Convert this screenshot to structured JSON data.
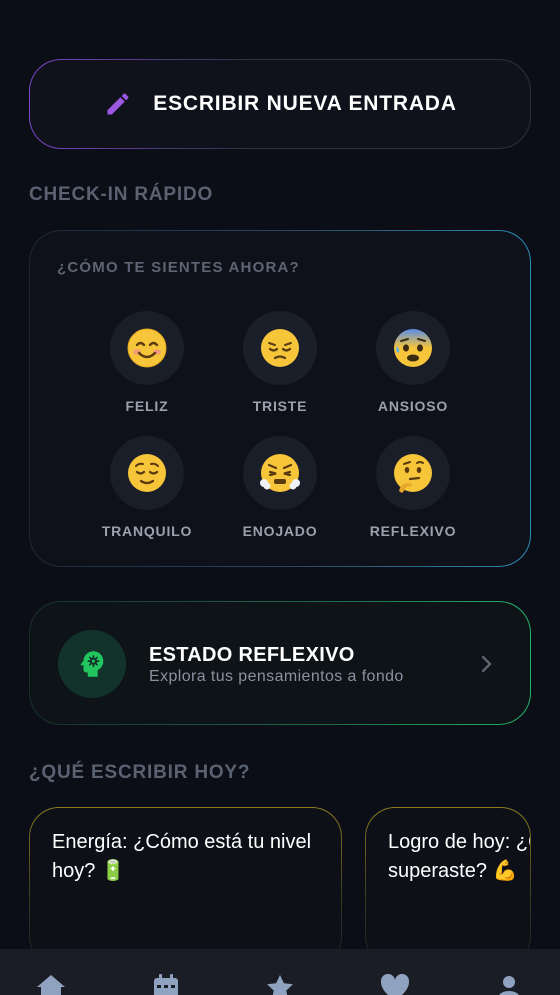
{
  "new_entry": {
    "label": "ESCRIBIR NUEVA ENTRADA",
    "icon": "pencil-icon"
  },
  "quick_checkin": {
    "section_title": "CHECK-IN RÁPIDO",
    "question": "¿CÓMO TE SIENTES AHORA?",
    "moods": [
      {
        "emoji": "😊",
        "label": "FELIZ"
      },
      {
        "emoji": "😔",
        "label": "TRISTE"
      },
      {
        "emoji": "😰",
        "label": "ANSIOSO"
      },
      {
        "emoji": "😌",
        "label": "TRANQUILO"
      },
      {
        "emoji": "😤",
        "label": "ENOJADO"
      },
      {
        "emoji": "🤔",
        "label": "REFLEXIVO"
      }
    ]
  },
  "state_card": {
    "title": "ESTADO REFLEXIVO",
    "subtitle": "Explora tus pensamientos a fondo",
    "icon": "head-gear-icon",
    "accent": "#22c55e"
  },
  "prompts": {
    "section_title": "¿QUÉ ESCRIBIR HOY?",
    "cards": [
      {
        "line1": "Energía: ¿Cómo está tu nivel",
        "line2": "hoy? 🔋"
      },
      {
        "line1": "Logro de hoy: ¿Q",
        "line2": "superaste? 💪"
      }
    ]
  },
  "bottom_nav": {
    "items": [
      "home-icon",
      "calendar-icon",
      "star-icon",
      "heart-icon",
      "user-icon"
    ]
  },
  "colors": {
    "background": "#0b0e17",
    "purple_accent": "#7c45c4",
    "blue_accent": "#2b8db6",
    "green_accent": "#22b36a",
    "yellow_accent": "#8a7a1e"
  }
}
